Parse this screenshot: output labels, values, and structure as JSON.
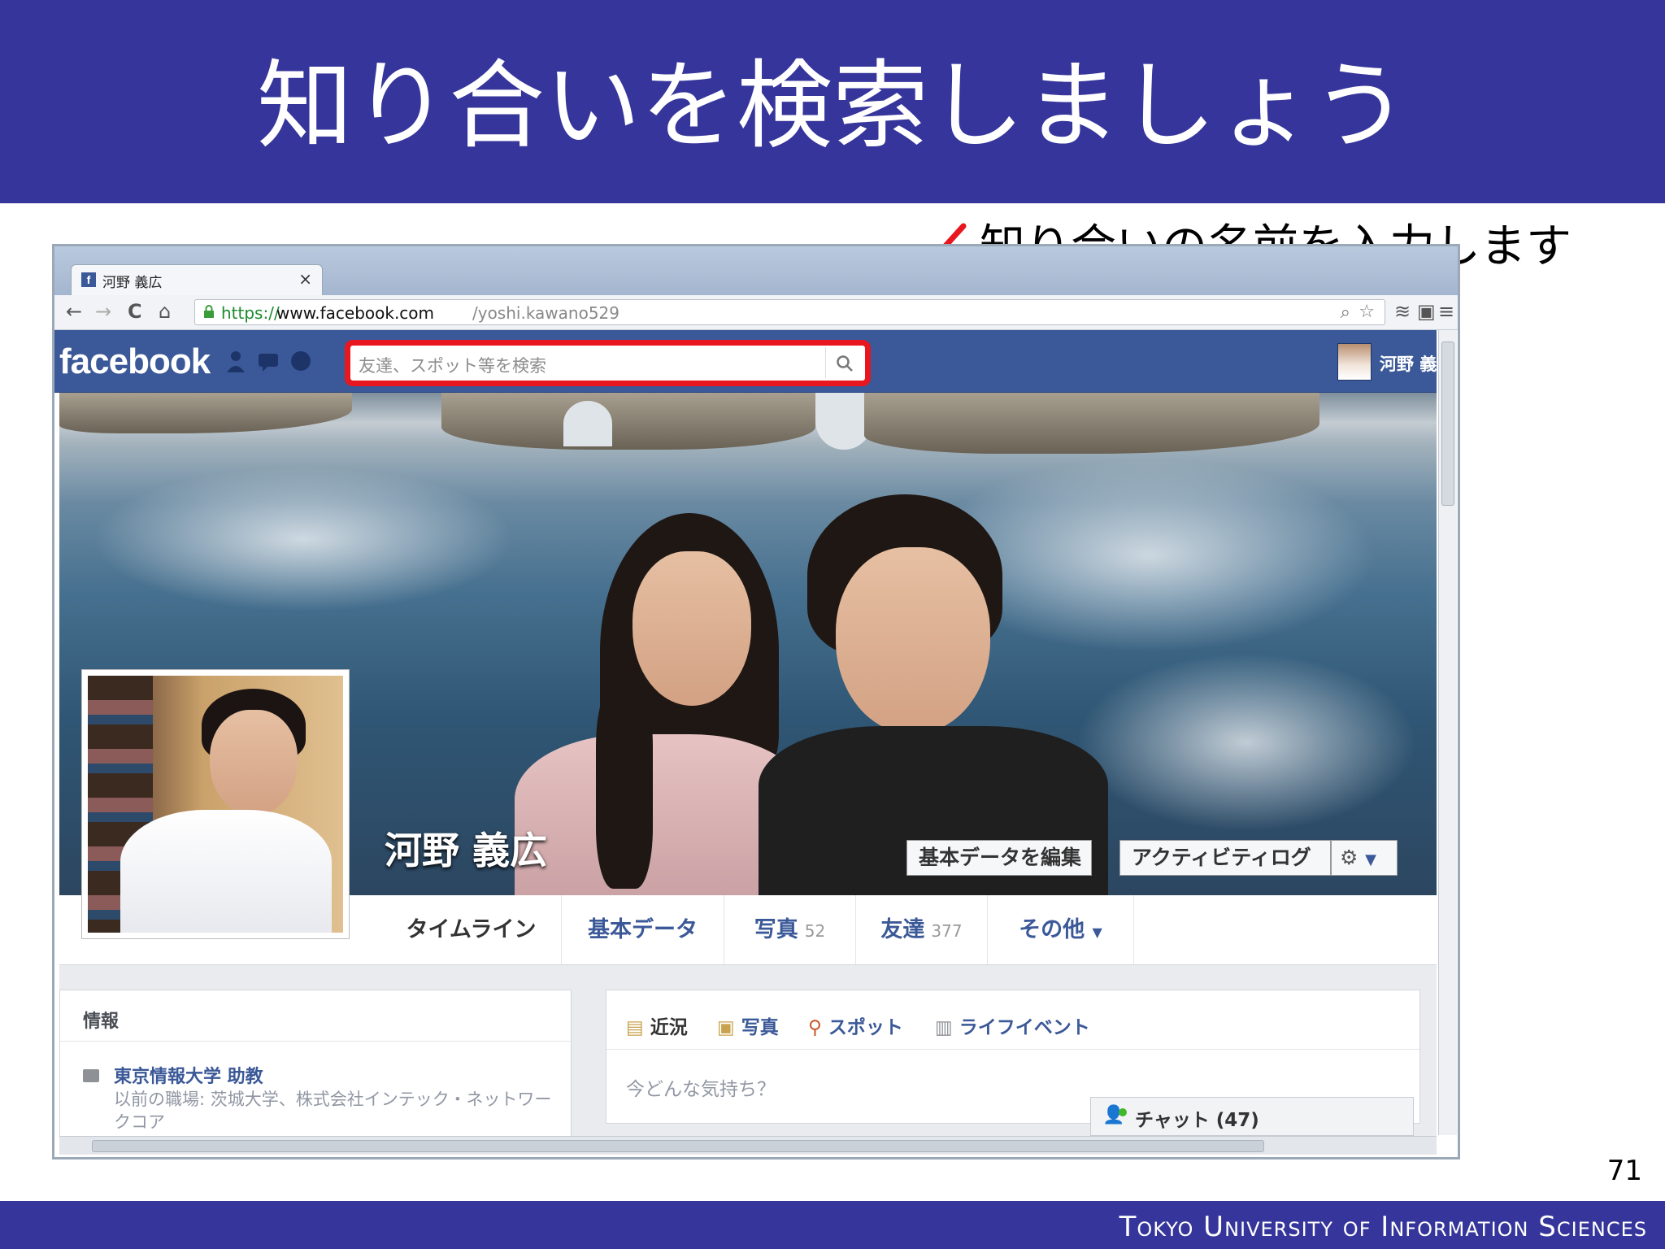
{
  "slide": {
    "title": "知り合いを検索しましょう",
    "callout": "知り合いの名前を入力します",
    "page_number": "71",
    "footer": "Tokyo University of Information Sciences"
  },
  "browser": {
    "tab_title": "河野 義広",
    "tab_close": "×",
    "url_scheme": "https://",
    "url_host": "www.facebook.com",
    "url_path": "/yoshi.kawano529"
  },
  "facebook": {
    "logo": "facebook",
    "search_placeholder": "友達、スポット等を検索",
    "user_name": "河野 義",
    "profile_name": "河野 義広",
    "edit_button": "基本データを編集",
    "activity_button": "アクティビティログ",
    "nav": {
      "timeline": "タイムライン",
      "about": "基本データ",
      "photos": "写真",
      "photos_count": "52",
      "friends": "友達",
      "friends_count": "377",
      "more": "その他"
    },
    "info": {
      "heading": "情報",
      "work": "東京情報大学 助教",
      "previous": "以前の職場: 茨城大学、株式会社インテック・ネットワークコア"
    },
    "composer": {
      "status": "近況",
      "photo": "写真",
      "place": "スポット",
      "life_event": "ライフイベント",
      "prompt": "今どんな気持ち？"
    },
    "chat": "チャット (47)"
  },
  "colors": {
    "slide_blue": "#35359b",
    "facebook_blue": "#3b5998",
    "highlight_red": "#e8161f"
  }
}
